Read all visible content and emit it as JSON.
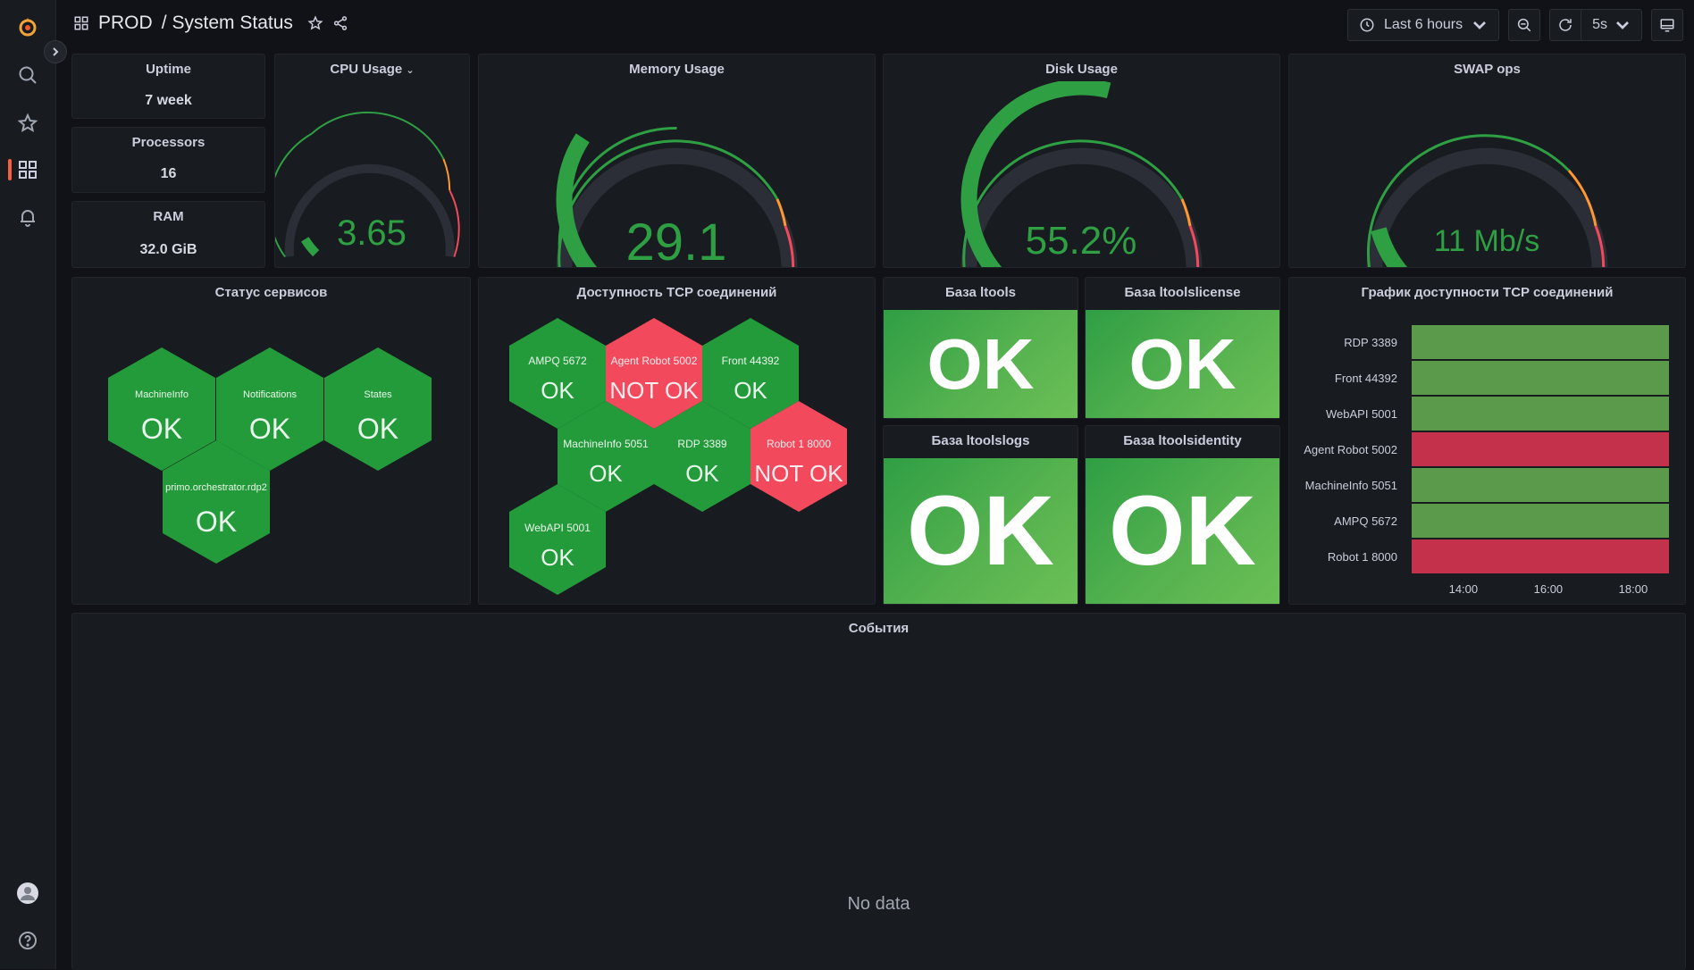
{
  "topbar": {
    "folder": "PROD",
    "separator": "/",
    "dashboard_title": "System Status",
    "time_range": "Last 6 hours",
    "refresh_interval": "5s"
  },
  "sidebar": {
    "items": [
      "grafana-logo",
      "search-icon",
      "star-icon",
      "dashboards-icon",
      "bell-icon"
    ],
    "bottom": [
      "avatar",
      "help-icon"
    ],
    "active_color": "#f55f3e"
  },
  "stats": {
    "uptime": {
      "title": "Uptime",
      "value": "7 week"
    },
    "processors": {
      "title": "Processors",
      "value": "16"
    },
    "ram": {
      "title": "RAM",
      "value": "32.0 GiB"
    }
  },
  "gauges": {
    "cpu": {
      "title": "CPU Usage",
      "value": "3.65",
      "fraction": 0.05
    },
    "memory": {
      "title": "Memory Usage",
      "value": "29.1",
      "fraction": 0.29
    },
    "disk": {
      "title": "Disk Usage",
      "value": "55.2%",
      "fraction": 0.552
    },
    "swap": {
      "title": "SWAP ops",
      "value": "11 Mb/s",
      "fraction": 0.11
    }
  },
  "services": {
    "title": "Статус сервисов",
    "items": [
      {
        "name": "MachineInfo",
        "status": "OK"
      },
      {
        "name": "Notifications",
        "status": "OK"
      },
      {
        "name": "States",
        "status": "OK"
      },
      {
        "name": "primo.orchestrator.rdp2",
        "status": "OK"
      }
    ]
  },
  "tcp": {
    "title": "Доступность TCP соединений",
    "items": [
      {
        "name": "AMPQ 5672",
        "status": "OK"
      },
      {
        "name": "Agent Robot 5002",
        "status": "NOT OK"
      },
      {
        "name": "Front 44392",
        "status": "OK"
      },
      {
        "name": "MachineInfo 5051",
        "status": "OK"
      },
      {
        "name": "RDP 3389",
        "status": "OK"
      },
      {
        "name": "Robot 1 8000",
        "status": "NOT OK"
      },
      {
        "name": "WebAPI 5001",
        "status": "OK"
      }
    ]
  },
  "databases": {
    "ltools": {
      "title": "База ltools",
      "status": "OK"
    },
    "ltoolslicense": {
      "title": "База ltoolslicense",
      "status": "OK"
    },
    "ltoolslogs": {
      "title": "База ltoolslogs",
      "status": "OK"
    },
    "ltoolsidentity": {
      "title": "База ltoolsidentity",
      "status": "OK"
    }
  },
  "timeline": {
    "title": "График доступности TCP соединений",
    "rows": [
      {
        "label": "RDP 3389",
        "state": "up"
      },
      {
        "label": "Front 44392",
        "state": "up"
      },
      {
        "label": "WebAPI 5001",
        "state": "up"
      },
      {
        "label": "Agent Robot 5002",
        "state": "down"
      },
      {
        "label": "MachineInfo 5051",
        "state": "up"
      },
      {
        "label": "AMPQ 5672",
        "state": "up"
      },
      {
        "label": "Robot 1 8000",
        "state": "down"
      }
    ],
    "x_ticks": [
      "14:00",
      "16:00",
      "18:00"
    ]
  },
  "events": {
    "title": "События",
    "empty_text": "No data"
  },
  "colors": {
    "ok": "#2ea043",
    "not_ok": "#f2495c",
    "up_bar": "#5a9a4a",
    "down_bar": "#c4314b"
  }
}
